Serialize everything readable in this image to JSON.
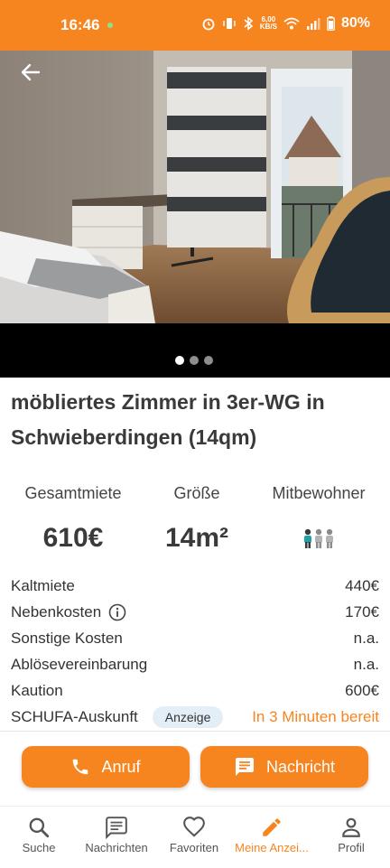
{
  "status": {
    "time": "16:46",
    "speed_top": "6,00",
    "speed_bottom": "KB/S",
    "battery": "80%"
  },
  "listing": {
    "title": "möbliertes Zimmer in 3er-WG in Schwieberdingen (14qm)",
    "image_count": 3,
    "active_image": 1
  },
  "facts": {
    "total_rent": {
      "label": "Gesamtmiete",
      "value": "610€"
    },
    "size": {
      "label": "Größe",
      "value": "14m²"
    },
    "roommates": {
      "label": "Mitbewohner"
    }
  },
  "details": {
    "cold_rent": {
      "label": "Kaltmiete",
      "value": "440€"
    },
    "utilities": {
      "label": "Nebenkosten",
      "value": "170€"
    },
    "other_costs": {
      "label": "Sonstige Kosten",
      "value": "n.a."
    },
    "transfer_fee": {
      "label": "Ablösevereinbarung",
      "value": "n.a."
    },
    "deposit": {
      "label": "Kaution",
      "value": "600€"
    },
    "schufa": {
      "label": "SCHUFA-Auskunft",
      "badge": "Anzeige",
      "value": "In 3 Minuten bereit"
    }
  },
  "actions": {
    "call": "Anruf",
    "message": "Nachricht"
  },
  "nav": {
    "search": "Suche",
    "messages": "Nachrichten",
    "favorites": "Favoriten",
    "my_ads": "Meine Anzei...",
    "profile": "Profil"
  },
  "colors": {
    "accent": "#f7851f",
    "badge_bg": "#e4eef6",
    "text": "#333333"
  }
}
